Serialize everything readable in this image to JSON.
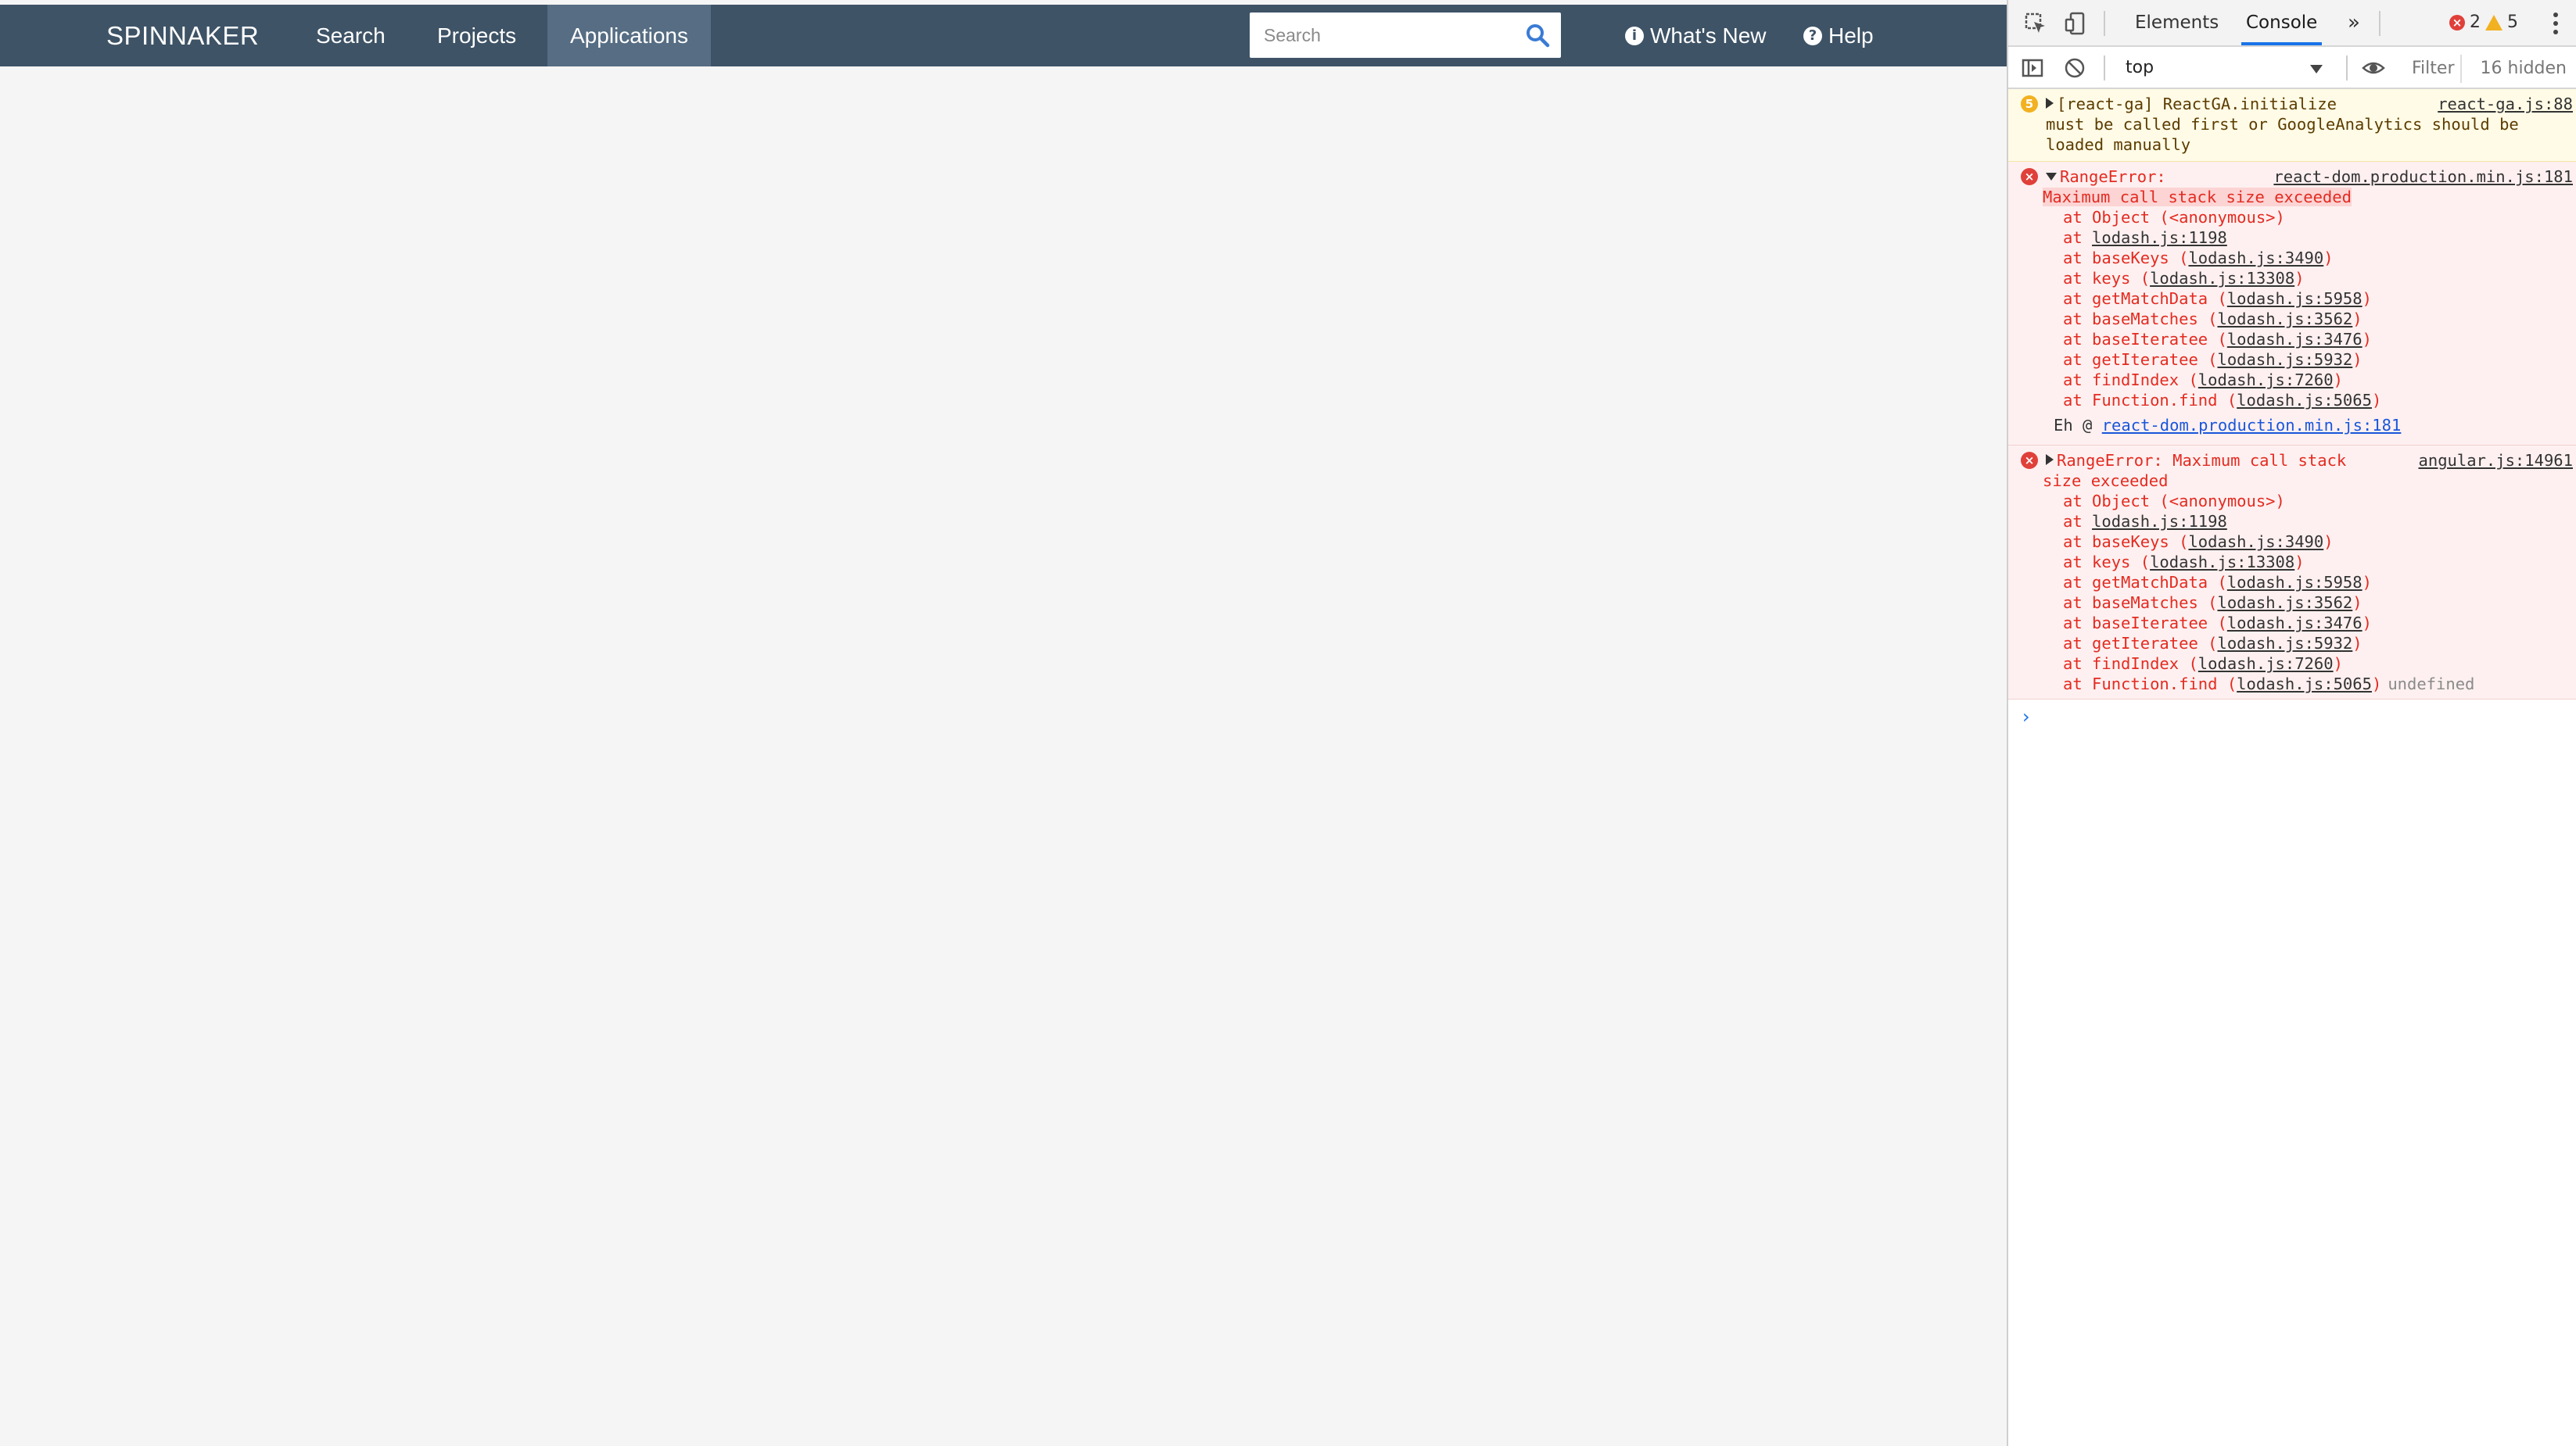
{
  "app": {
    "brand": "SPINNAKER",
    "nav": [
      "Search",
      "Projects",
      "Applications"
    ],
    "active_nav": "Applications",
    "search_placeholder": "Search",
    "whats_new": "What's New",
    "help": "Help",
    "colors": {
      "topbar": "#3e5366",
      "active": "#566d83",
      "background": "#f5f5f5"
    }
  },
  "devtools": {
    "tabs": [
      "Elements",
      "Console"
    ],
    "active_tab": "Console",
    "more_tabs": "»",
    "errors_count": "2",
    "warnings_count": "5",
    "context": "top",
    "filter_placeholder": "Filter",
    "hidden": "16 hidden",
    "messages": [
      {
        "level": "warning",
        "repeat": "5",
        "text_line1": "[react-ga] ReactGA.initialize",
        "text_line2": "must be called first or GoogleAnalytics should be",
        "text_line3": "loaded manually",
        "source": "react-ga.js:88"
      },
      {
        "level": "error",
        "title": "RangeError:",
        "title_line2": "Maximum call stack size exceeded",
        "source": "react-dom.production.min.js:181",
        "frames": [
          {
            "prefix": "at Object (<anonymous>)",
            "fn": "",
            "link": ""
          },
          {
            "prefix": "at ",
            "fn": "",
            "link": "lodash.js:1198"
          },
          {
            "prefix": "at baseKeys (",
            "fn": "baseKeys",
            "link": "lodash.js:3490"
          },
          {
            "prefix": "at keys (",
            "fn": "keys",
            "link": "lodash.js:13308"
          },
          {
            "prefix": "at getMatchData (",
            "fn": "getMatchData",
            "link": "lodash.js:5958"
          },
          {
            "prefix": "at baseMatches (",
            "fn": "baseMatches",
            "link": "lodash.js:3562"
          },
          {
            "prefix": "at baseIteratee (",
            "fn": "baseIteratee",
            "link": "lodash.js:3476"
          },
          {
            "prefix": "at getIteratee (",
            "fn": "getIteratee",
            "link": "lodash.js:5932"
          },
          {
            "prefix": "at findIndex (",
            "fn": "findIndex",
            "link": "lodash.js:7260"
          },
          {
            "prefix": "at Function.find (",
            "fn": "Function.find",
            "link": "lodash.js:5065"
          }
        ],
        "eh_prefix": "Eh @ ",
        "eh_link": "react-dom.production.min.js:181"
      },
      {
        "level": "error",
        "title": "RangeError: Maximum call stack",
        "title_line2": "size exceeded",
        "source": "angular.js:14961",
        "frames": [
          {
            "prefix": "at Object (<anonymous>)",
            "fn": "",
            "link": ""
          },
          {
            "prefix": "at ",
            "fn": "",
            "link": "lodash.js:1198"
          },
          {
            "prefix": "at baseKeys (",
            "fn": "baseKeys",
            "link": "lodash.js:3490"
          },
          {
            "prefix": "at keys (",
            "fn": "keys",
            "link": "lodash.js:13308"
          },
          {
            "prefix": "at getMatchData (",
            "fn": "getMatchData",
            "link": "lodash.js:5958"
          },
          {
            "prefix": "at baseMatches (",
            "fn": "baseMatches",
            "link": "lodash.js:3562"
          },
          {
            "prefix": "at baseIteratee (",
            "fn": "baseIteratee",
            "link": "lodash.js:3476"
          },
          {
            "prefix": "at getIteratee (",
            "fn": "getIteratee",
            "link": "lodash.js:5932"
          },
          {
            "prefix": "at findIndex (",
            "fn": "findIndex",
            "link": "lodash.js:7260"
          },
          {
            "prefix": "at Function.find (",
            "fn": "Function.find",
            "link": "lodash.js:5065"
          }
        ],
        "trailing": "undefined"
      }
    ],
    "prompt": "›"
  }
}
